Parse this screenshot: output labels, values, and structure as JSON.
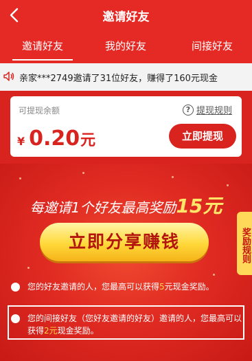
{
  "header": {
    "back_icon": "chevron-left-icon",
    "title": "邀请好友"
  },
  "tabs": [
    {
      "label": "邀请好友",
      "active": true
    },
    {
      "label": "我的好友",
      "active": false
    },
    {
      "label": "间接好友",
      "active": false
    }
  ],
  "notice": {
    "icon": "speaker-icon",
    "text": "亲家***2749邀请了31位好友，赚得了160元现金"
  },
  "balance": {
    "label": "可提现余额",
    "currency": "¥",
    "amount": "0.20",
    "unit": "元",
    "rule_link": "提现规则",
    "withdraw_button": "立即提现"
  },
  "promo": {
    "line_prefix": "每邀请1个好友最高奖励",
    "line_amount": "15元",
    "share_button": "立即分享赚钱",
    "side_tab": "奖励规则"
  },
  "rules": [
    {
      "prefix": "您的好友邀请的人，您最高可以获得",
      "amount": "5",
      "suffix": "元现金奖励。"
    },
    {
      "prefix": "您的间接好友（您好友邀请的好友）邀请的人，您最高可以获得",
      "amount": "2元",
      "suffix": "现金奖励。"
    }
  ],
  "colors": {
    "brand_red": "#d9231f",
    "highlight_yellow": "#ffd24a"
  }
}
